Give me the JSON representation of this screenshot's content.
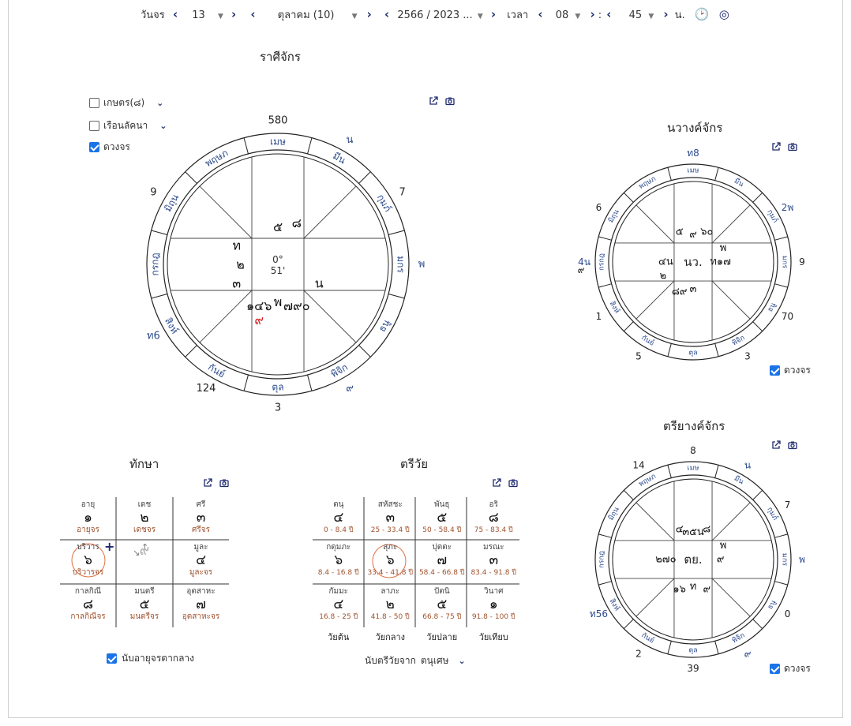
{
  "nav": {
    "day_label": "วันจร",
    "day": "13",
    "month": "ตุลาคม (10)",
    "year": "2566 / 2023 ...",
    "time_label": "เวลา",
    "hour": "08",
    "colon": ":",
    "minute": "45",
    "unit": "น."
  },
  "rasi": {
    "title": "ราศีจักร",
    "options": [
      {
        "label": "เกษตร(๘)",
        "checked": false,
        "dropdown": true
      },
      {
        "label": "เรือนลัคนา",
        "checked": false,
        "dropdown": true
      },
      {
        "label": "ดวงจร",
        "checked": true,
        "dropdown": false
      }
    ],
    "center_deg": "0°",
    "center_min": "51'",
    "signs": [
      "เมษ",
      "มีน",
      "กุมภ์",
      "มกร",
      "ธนู",
      "พิจิก",
      "ตุล",
      "กันย์",
      "สิงห์",
      "กรกฎ",
      "มิถุน",
      "พฤษภ"
    ],
    "outer": [
      "580",
      "น",
      "7",
      "พ",
      "",
      "๙",
      "3",
      "124",
      "ท6",
      "",
      "9",
      ""
    ],
    "houses": [
      "๕",
      "๘",
      "",
      "",
      "น",
      "๗๙๐",
      "พ",
      "๑๔๖",
      "๓",
      "๒",
      "ท",
      ""
    ],
    "house_red": [
      "",
      "",
      "",
      "",
      "",
      "",
      "",
      "๙",
      "",
      "",
      "",
      ""
    ]
  },
  "navang": {
    "title": "นวางค์จักร",
    "center": "นว.",
    "signs": [
      "เมษ",
      "มีน",
      "กุมภ์",
      "มกร",
      "ธนู",
      "พิจิก",
      "ตุล",
      "กันย์",
      "สิงห์",
      "กรกฎ",
      "มิถุน",
      "พฤษภ"
    ],
    "outer": [
      "ท8",
      "",
      "2พ",
      "9",
      "70",
      "3",
      "",
      "5",
      "1",
      "4น",
      "6",
      ""
    ],
    "outer_extra": "๙",
    "houses": [
      "๙",
      "๖๐",
      "พ",
      "ท๑๗",
      "",
      "",
      "๓",
      "๘๙",
      "๒",
      "๔น",
      "",
      "๕"
    ],
    "option": "ดวงจร"
  },
  "treeyang": {
    "title": "ตรียางค์จักร",
    "center": "ตย.",
    "signs": [
      "เมษ",
      "มีน",
      "กุมภ์",
      "มกร",
      "ธนู",
      "พิจิก",
      "ตุล",
      "กันย์",
      "สิงห์",
      "กรกฎ",
      "มิถุน",
      "พฤษภ"
    ],
    "outer": [
      "8",
      "น",
      "7",
      "พ",
      "0",
      "๙",
      "39",
      "2",
      "ท56",
      "",
      "",
      "14"
    ],
    "houses": [
      "๓๕น",
      "๘",
      "พ",
      "๙",
      "",
      "๙",
      "ท",
      "๑๖",
      "",
      "๒๗๐",
      "",
      "๔"
    ],
    "option": "ดวงจร"
  },
  "taksa": {
    "title": "ทักษา",
    "cells": [
      {
        "label": "อายุ",
        "value": "๑",
        "sub": "อายุจร"
      },
      {
        "label": "เดช",
        "value": "๒",
        "sub": "เดชจร"
      },
      {
        "label": "ศรี",
        "value": "๓",
        "sub": "ศรีจร"
      },
      {
        "label": "บริวาร",
        "value": "๖",
        "sub": "บริวารจร"
      },
      {
        "label": "",
        "value": "๙",
        "sub": ""
      },
      {
        "label": "มูละ",
        "value": "๔",
        "sub": "มูละจร"
      },
      {
        "label": "กาลกิณี",
        "value": "๘",
        "sub": "กาลกิณีจร"
      },
      {
        "label": "มนตรี",
        "value": "๕",
        "sub": "มนตรีจร"
      },
      {
        "label": "อุตสาหะ",
        "value": "๗",
        "sub": "อุตสาหะจร"
      }
    ],
    "option": "นับอายุจรตากลาง"
  },
  "triwai": {
    "title": "ตรีวัย",
    "cells": [
      {
        "label": "ตนุ",
        "value": "๔",
        "sub": "0 - 8.4 ปี"
      },
      {
        "label": "สหัสชะ",
        "value": "๓",
        "sub": "25 - 33.4 ปี"
      },
      {
        "label": "พันธุ",
        "value": "๕",
        "sub": "50 - 58.4 ปี"
      },
      {
        "label": "อริ",
        "value": "๘",
        "sub": "75 - 83.4 ปี"
      },
      {
        "label": "กดุมภะ",
        "value": "๖",
        "sub": "8.4 - 16.8 ปี"
      },
      {
        "label": "สุภะ",
        "value": "๖",
        "sub": "33.4 - 41.8 ปี"
      },
      {
        "label": "ปุตตะ",
        "value": "๗",
        "sub": "58.4 - 66.8 ปี"
      },
      {
        "label": "มรณะ",
        "value": "๓",
        "sub": "83.4 - 91.8 ปี"
      },
      {
        "label": "กัมมะ",
        "value": "๔",
        "sub": "16.8 - 25 ปี"
      },
      {
        "label": "ลาภะ",
        "value": "๒",
        "sub": "41.8 - 50 ปี"
      },
      {
        "label": "ปัตนิ",
        "value": "๕",
        "sub": "66.8 - 75 ปี"
      },
      {
        "label": "วินาศ",
        "value": "๑",
        "sub": "91.8 - 100 ปี"
      }
    ],
    "footer": [
      "วัยต้น",
      "วัยกลาง",
      "วัยปลาย",
      "วัยเทียบ"
    ],
    "option_label": "นับตรีวัยจาก",
    "option_value": "ตนุเศษ"
  },
  "colors": {
    "accent": "#1e2a6e",
    "sign_text": "#2b4a8c",
    "red": "#d62020",
    "brown": "#a0522d",
    "highlight": "#e07040"
  }
}
